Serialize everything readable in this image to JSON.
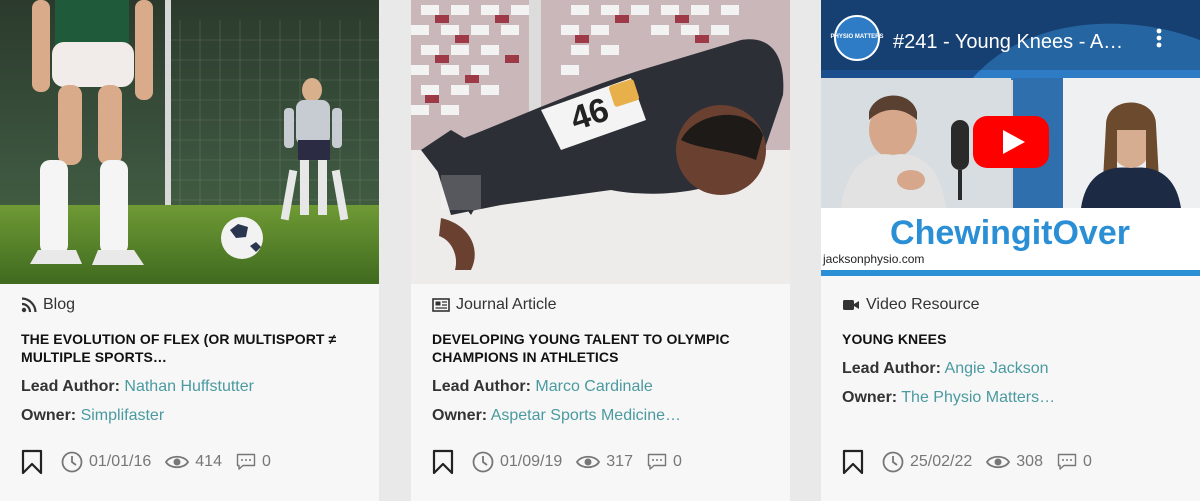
{
  "cards": [
    {
      "type_icon": "rss-icon",
      "type_label": "Blog",
      "title": "THE EVOLUTION OF FLEX (OR MULTISPORT ≠ MULTIPLE SPORTS…",
      "lead_author_label": "Lead Author:",
      "lead_author": "Nathan Huffstutter",
      "owner_label": "Owner:",
      "owner": "Simplifaster",
      "date": "01/01/16",
      "views": "414",
      "comments": "0"
    },
    {
      "type_icon": "newspaper-icon",
      "type_label": "Journal Article",
      "title": "DEVELOPING YOUNG TALENT TO OLYMPIC CHAMPIONS IN ATHLETICS",
      "lead_author_label": "Lead Author:",
      "lead_author": "Marco Cardinale",
      "owner_label": "Owner:",
      "owner": "Aspetar Sports Medicine…",
      "date": "01/09/19",
      "views": "317",
      "comments": "0",
      "bib_number": "46"
    },
    {
      "type_icon": "video-camera-icon",
      "type_label": "Video Resource",
      "title": "YOUNG KNEES",
      "lead_author_label": "Lead Author:",
      "lead_author": "Angie Jackson",
      "owner_label": "Owner:",
      "owner": "The Physio Matters…",
      "date": "25/02/22",
      "views": "308",
      "comments": "0",
      "video_title": "#241 - Young Knees - A…",
      "banner_text": "ChewingitOver",
      "site_text": "jacksonphysio.com",
      "channel_logo_text": "PHYSIO MATTERS"
    }
  ],
  "colors": {
    "link": "#4a9aa0",
    "card_bg": "#f7f7f7",
    "page_bg": "#e9e9e9",
    "youtube_red": "#ff0000",
    "banner_blue": "#2b8fd6"
  }
}
